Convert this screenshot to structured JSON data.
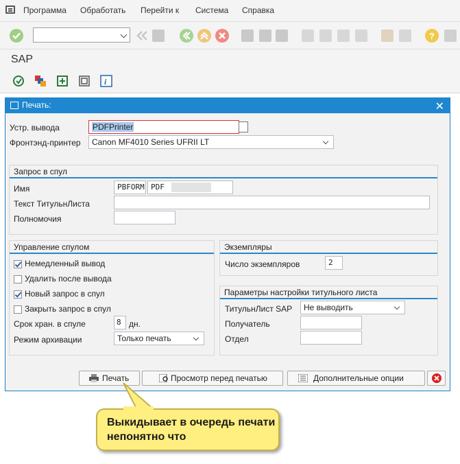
{
  "menubar": {
    "items": [
      "Программа",
      "Обработать",
      "Перейти к",
      "Система",
      "Справка"
    ]
  },
  "app": {
    "title": "SAP"
  },
  "dialog": {
    "title": "Печать:",
    "output_device": {
      "label": "Устр. вывода",
      "value": "PDFPrinter"
    },
    "frontend_printer": {
      "label": "Фронтэнд-принтер",
      "value": "Canon MF4010 Series UFRII LT"
    },
    "spool_request": {
      "title": "Запрос в спул",
      "name_label": "Имя",
      "name_values": [
        "PBFORM",
        "PDF"
      ],
      "cover_text_label": "Текст ТитульнЛиста",
      "cover_text_value": "",
      "authority_label": "Полномочия",
      "authority_value": ""
    },
    "spool_control": {
      "title": "Управление спулом",
      "print_immediately": {
        "label": "Немедленный вывод",
        "checked": true
      },
      "delete_after_output": {
        "label": "Удалить после вывода",
        "checked": false
      },
      "new_spool_request": {
        "label": "Новый запрос в спул",
        "checked": true
      },
      "close_spool_request": {
        "label": "Закрыть запрос в спул",
        "checked": false
      },
      "retention_label": "Срок хран. в спуле",
      "retention_value": "8",
      "retention_unit": "дн.",
      "archiving_label": "Режим архивации",
      "archiving_value": "Только печать"
    },
    "copies": {
      "title": "Экземпляры",
      "count_label": "Число экземпляров",
      "count_value": "2"
    },
    "cover_settings": {
      "title": "Параметры настройки титульного листа",
      "sap_cover_label": "ТитульнЛист SAP",
      "sap_cover_value": "Не выводить",
      "recipient_label": "Получатель",
      "recipient_value": "",
      "department_label": "Отдел",
      "department_value": ""
    },
    "buttons": {
      "print": "Печать",
      "preview": "Просмотр перед печатью",
      "options": "Дополнительные опции"
    }
  },
  "callout": {
    "text": "Выкидывает в очередь печати непонятно что"
  },
  "colors": {
    "header_blue": "#1e87cf",
    "group_line": "#2a86c8",
    "callout_fill": "#ffef80",
    "cancel_red": "#d9201f"
  }
}
